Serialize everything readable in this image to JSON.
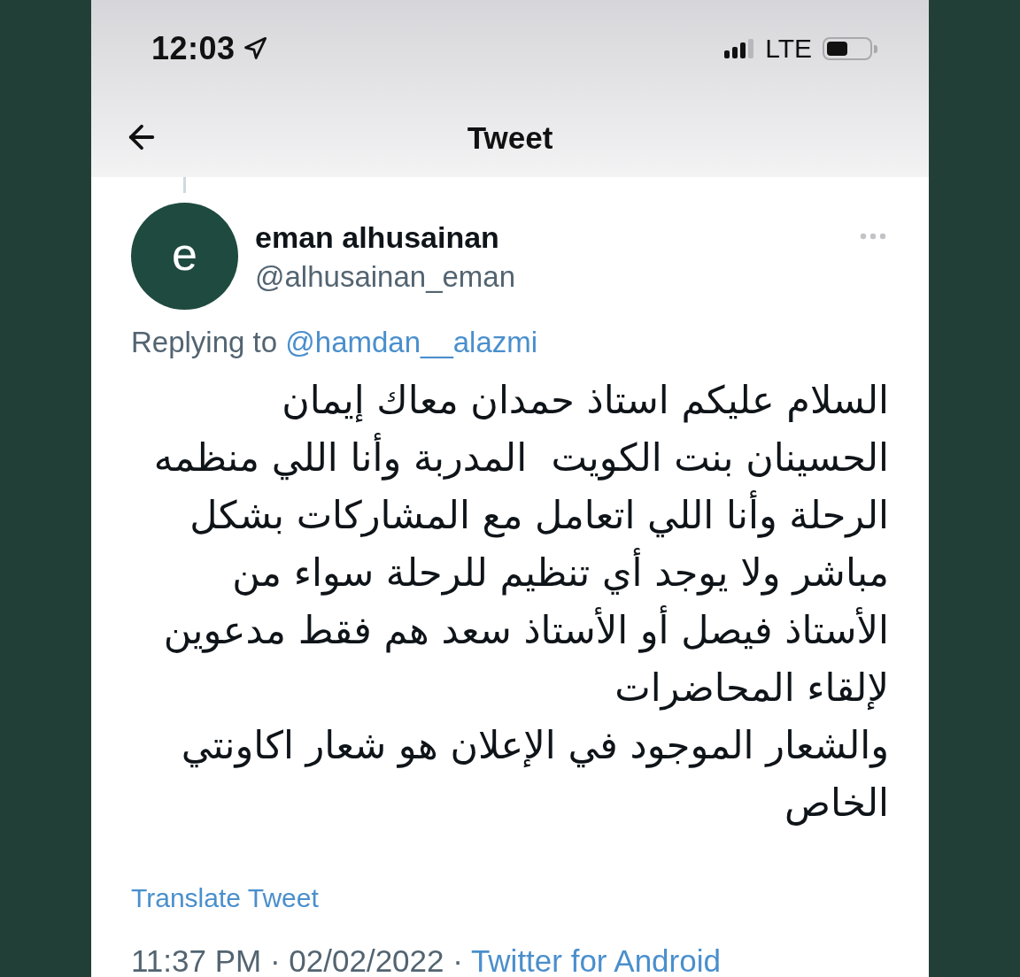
{
  "status_bar": {
    "time": "12:03",
    "network": "LTE",
    "battery": {
      "level": 0.5
    }
  },
  "header": {
    "title": "Tweet"
  },
  "tweet": {
    "author": {
      "initial": "e",
      "name": "eman alhusainan",
      "handle": "@alhusainan_eman"
    },
    "replying_to": {
      "label": "Replying to",
      "handle": "@hamdan__alazmi"
    },
    "text_lines": [
      "السلام عليكم استاذ حمدان معاك إيمان",
      "الحسينان بنت الكويت  المدربة وأنا اللي منظمه",
      "الرحلة وأنا اللي اتعامل مع المشاركات بشكل",
      "مباشر ولا يوجد أي تنظيم للرحلة سواء من",
      "الأستاذ فيصل أو الأستاذ سعد هم فقط مدعوين",
      "لإلقاء المحاضرات",
      "والشعار الموجود في الإعلان هو شعار اكاونتي",
      "الخاص"
    ],
    "translate_link": "Translate Tweet",
    "timestamp": "11:37 PM · 02/02/2022 ·",
    "source": "Twitter for Android"
  }
}
